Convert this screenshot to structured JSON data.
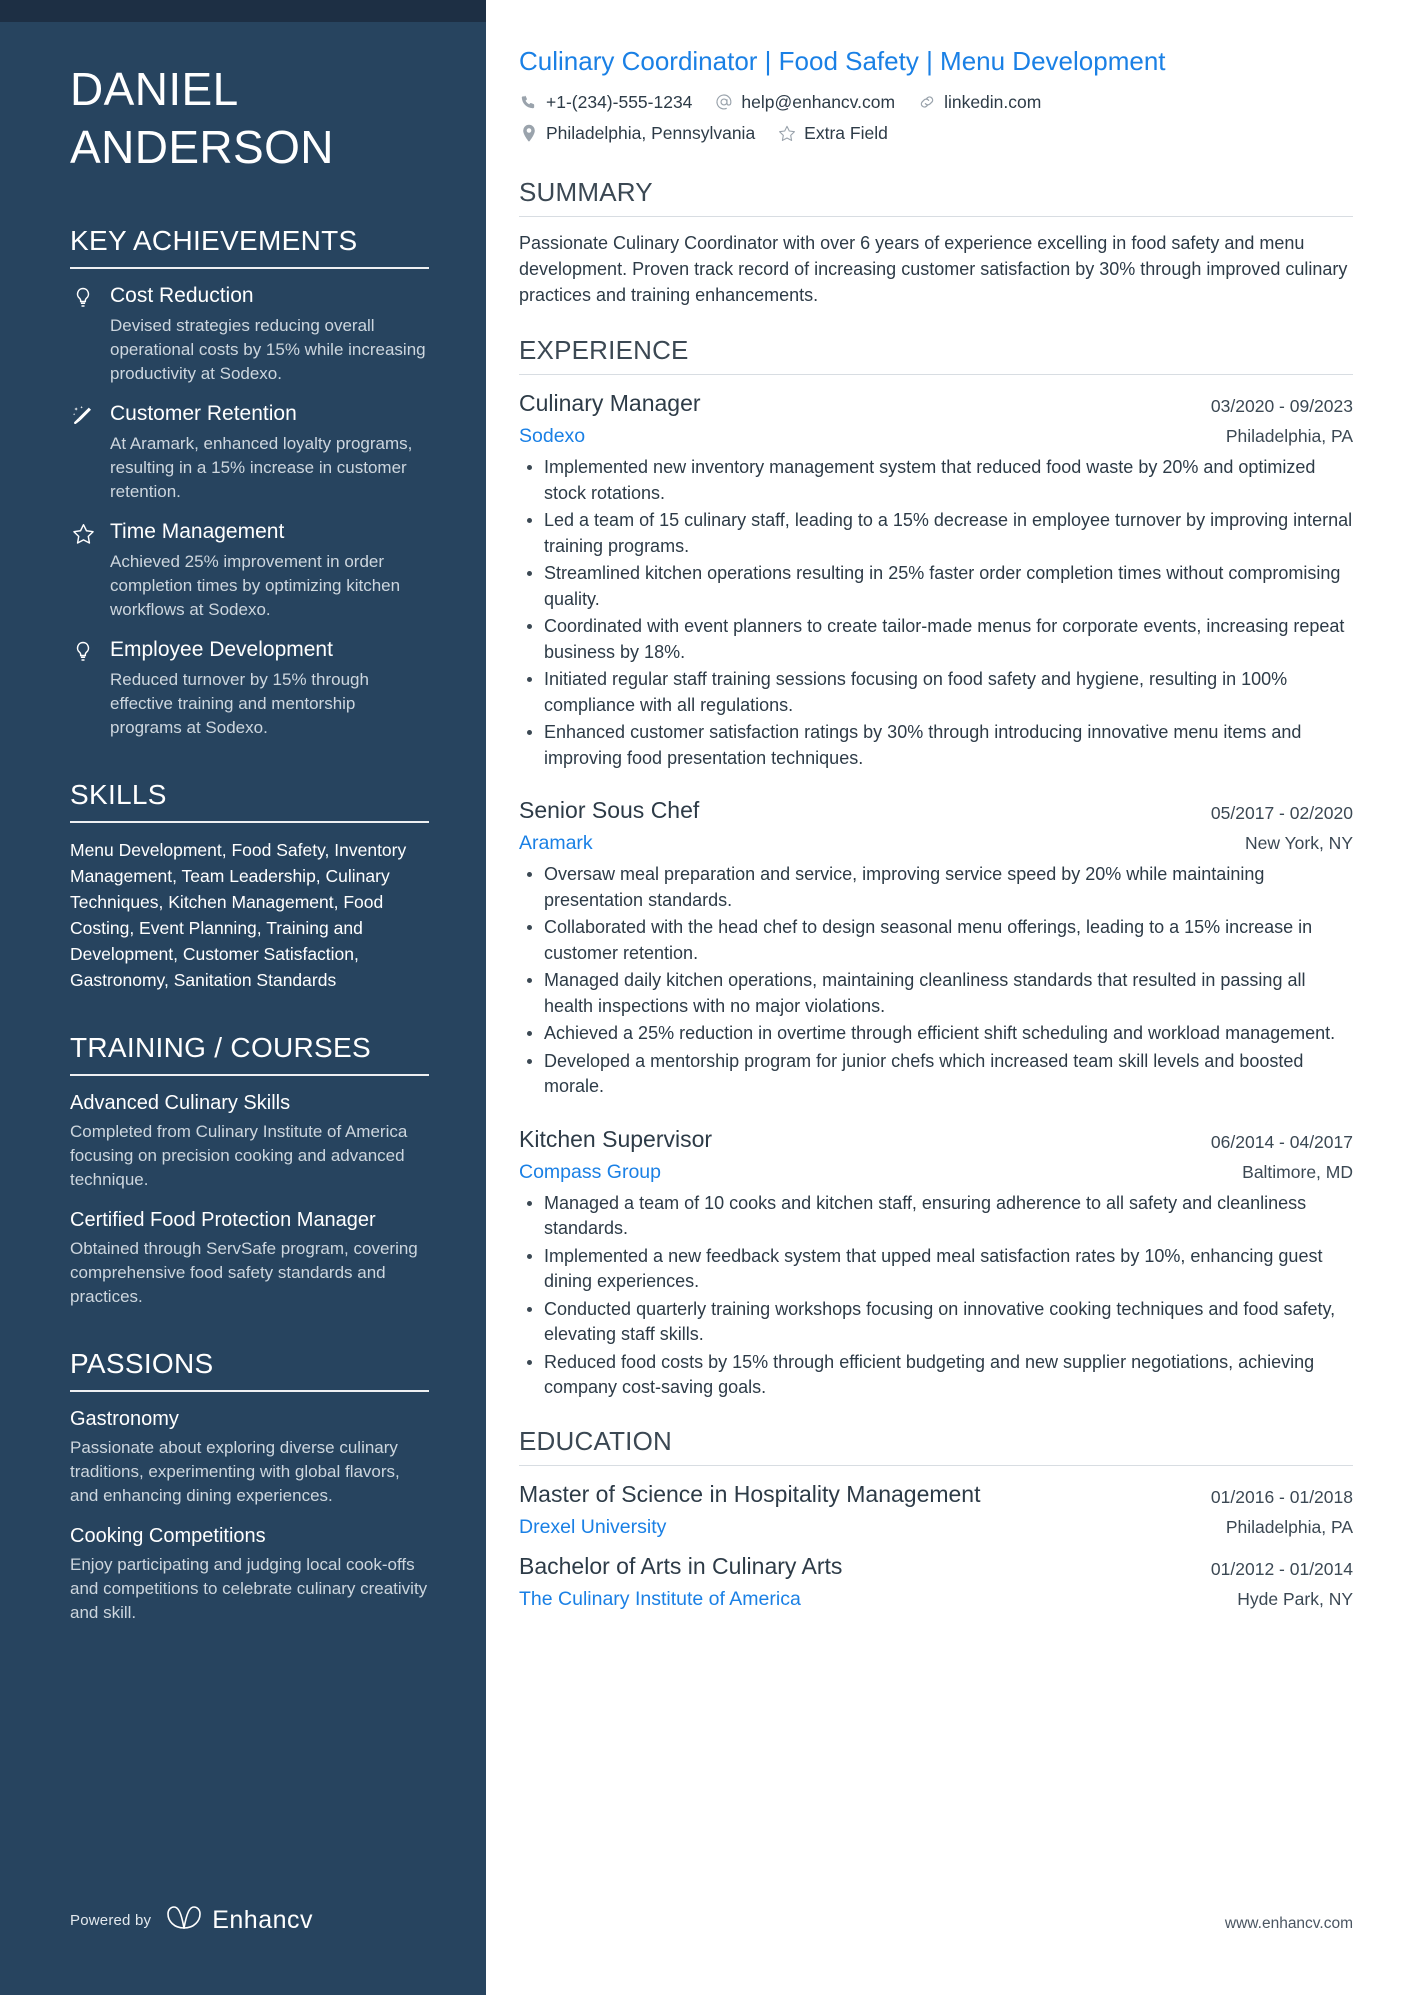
{
  "sidebar": {
    "name_lines": [
      "DANIEL",
      "ANDERSON"
    ],
    "sections": {
      "achievements": {
        "title": "KEY ACHIEVEMENTS",
        "items": [
          {
            "icon": "lightbulb-icon",
            "title": "Cost Reduction",
            "desc": "Devised strategies reducing overall operational costs by 15% while increasing productivity at Sodexo."
          },
          {
            "icon": "magic-wand-icon",
            "title": "Customer Retention",
            "desc": "At Aramark, enhanced loyalty programs, resulting in a 15% increase in customer retention."
          },
          {
            "icon": "star-icon",
            "title": "Time Management",
            "desc": "Achieved 25% improvement in order completion times by optimizing kitchen workflows at Sodexo."
          },
          {
            "icon": "lightbulb-icon",
            "title": "Employee Development",
            "desc": "Reduced turnover by 15% through effective training and mentorship programs at Sodexo."
          }
        ]
      },
      "skills": {
        "title": "SKILLS",
        "text": "Menu Development, Food Safety, Inventory Management, Team Leadership, Culinary Techniques, Kitchen Management, Food Costing, Event Planning, Training and Development, Customer Satisfaction, Gastronomy, Sanitation Standards"
      },
      "training": {
        "title": "TRAINING / COURSES",
        "items": [
          {
            "title": "Advanced Culinary Skills",
            "desc": "Completed from Culinary Institute of America focusing on precision cooking and advanced technique."
          },
          {
            "title": "Certified Food Protection Manager",
            "desc": "Obtained through ServSafe program, covering comprehensive food safety standards and practices."
          }
        ]
      },
      "passions": {
        "title": "PASSIONS",
        "items": [
          {
            "title": "Gastronomy",
            "desc": "Passionate about exploring diverse culinary traditions, experimenting with global flavors, and enhancing dining experiences."
          },
          {
            "title": "Cooking Competitions",
            "desc": "Enjoy participating and judging local cook-offs and competitions to celebrate culinary creativity and skill."
          }
        ]
      }
    },
    "footer": {
      "powered_by": "Powered by",
      "brand": "Enhancv"
    }
  },
  "main": {
    "headline": "Culinary Coordinator | Food Safety | Menu Development",
    "contact_rows": [
      [
        {
          "icon": "phone-icon",
          "text": "+1-(234)-555-1234"
        },
        {
          "icon": "at-sign-icon",
          "text": "help@enhancv.com"
        },
        {
          "icon": "link-icon",
          "text": "linkedin.com"
        }
      ],
      [
        {
          "icon": "map-pin-icon",
          "text": "Philadelphia, Pennsylvania"
        },
        {
          "icon": "star-icon",
          "text": "Extra Field"
        }
      ]
    ],
    "summary": {
      "title": "SUMMARY",
      "text": "Passionate Culinary Coordinator with over 6 years of experience excelling in food safety and menu development. Proven track record of increasing customer satisfaction by 30% through improved culinary practices and training enhancements."
    },
    "experience": {
      "title": "EXPERIENCE",
      "entries": [
        {
          "title": "Culinary Manager",
          "date": "03/2020 - 09/2023",
          "company": "Sodexo",
          "location": "Philadelphia, PA",
          "bullets": [
            "Implemented new inventory management system that reduced food waste by 20% and optimized stock rotations.",
            "Led a team of 15 culinary staff, leading to a 15% decrease in employee turnover by improving internal training programs.",
            "Streamlined kitchen operations resulting in 25% faster order completion times without compromising quality.",
            "Coordinated with event planners to create tailor-made menus for corporate events, increasing repeat business by 18%.",
            "Initiated regular staff training sessions focusing on food safety and hygiene, resulting in 100% compliance with all regulations.",
            "Enhanced customer satisfaction ratings by 30% through introducing innovative menu items and improving food presentation techniques."
          ]
        },
        {
          "title": "Senior Sous Chef",
          "date": "05/2017 - 02/2020",
          "company": "Aramark",
          "location": "New York, NY",
          "bullets": [
            "Oversaw meal preparation and service, improving service speed by 20% while maintaining presentation standards.",
            "Collaborated with the head chef to design seasonal menu offerings, leading to a 15% increase in customer retention.",
            "Managed daily kitchen operations, maintaining cleanliness standards that resulted in passing all health inspections with no major violations.",
            "Achieved a 25% reduction in overtime through efficient shift scheduling and workload management.",
            "Developed a mentorship program for junior chefs which increased team skill levels and boosted morale."
          ]
        },
        {
          "title": "Kitchen Supervisor",
          "date": "06/2014 - 04/2017",
          "company": "Compass Group",
          "location": "Baltimore, MD",
          "bullets": [
            "Managed a team of 10 cooks and kitchen staff, ensuring adherence to all safety and cleanliness standards.",
            "Implemented a new feedback system that upped meal satisfaction rates by 10%, enhancing guest dining experiences.",
            "Conducted quarterly training workshops focusing on innovative cooking techniques and food safety, elevating staff skills.",
            "Reduced food costs by 15% through efficient budgeting and new supplier negotiations, achieving company cost-saving goals."
          ]
        }
      ]
    },
    "education": {
      "title": "EDUCATION",
      "entries": [
        {
          "title": "Master of Science in Hospitality Management",
          "date": "01/2016 - 01/2018",
          "school": "Drexel University",
          "location": "Philadelphia, PA"
        },
        {
          "title": "Bachelor of Arts in Culinary Arts",
          "date": "01/2012 - 01/2014",
          "school": "The Culinary Institute of America",
          "location": "Hyde Park, NY"
        }
      ]
    },
    "footer_url": "www.enhancv.com"
  },
  "colors": {
    "sidebar_bg": "#27445f",
    "sidebar_top_strip": "#1d2f44",
    "accent_blue": "#1a80e5",
    "body_text": "#2d3b47",
    "muted_text": "#cdd6de"
  }
}
